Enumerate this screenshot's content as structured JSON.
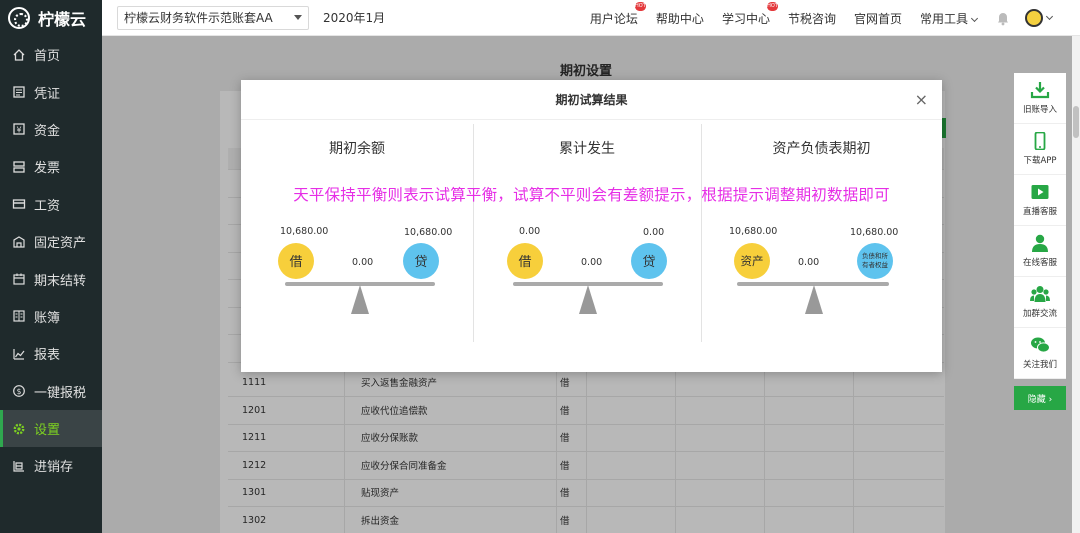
{
  "app": {
    "logo_text": "柠檬云"
  },
  "sidebar": {
    "items": [
      {
        "label": "首页",
        "icon": "home-icon"
      },
      {
        "label": "凭证",
        "icon": "voucher-icon"
      },
      {
        "label": "资金",
        "icon": "fund-icon"
      },
      {
        "label": "发票",
        "icon": "invoice-icon"
      },
      {
        "label": "工资",
        "icon": "salary-icon"
      },
      {
        "label": "固定资产",
        "icon": "asset-icon"
      },
      {
        "label": "期末结转",
        "icon": "calendar-icon"
      },
      {
        "label": "账簿",
        "icon": "book-icon"
      },
      {
        "label": "报表",
        "icon": "report-icon"
      },
      {
        "label": "一键报税",
        "icon": "tax-icon"
      },
      {
        "label": "设置",
        "icon": "gear-icon",
        "active": true
      },
      {
        "label": "进销存",
        "icon": "inventory-icon"
      }
    ]
  },
  "header": {
    "account_select": "柠檬云财务软件示范账套AA",
    "period": "2020年1月",
    "links": [
      "用户论坛",
      "帮助中心",
      "学习中心",
      "节税咨询",
      "官网首页",
      "常用工具"
    ],
    "hot_badge": "HOT"
  },
  "main": {
    "page_title": "期初设置",
    "rows": [
      {
        "code": "1111",
        "name": "买入返售金融资产",
        "dir": "借"
      },
      {
        "code": "1201",
        "name": "应收代位追偿款",
        "dir": "借"
      },
      {
        "code": "1211",
        "name": "应收分保账款",
        "dir": "借"
      },
      {
        "code": "1212",
        "name": "应收分保合同准备金",
        "dir": "借"
      },
      {
        "code": "1301",
        "name": "贴现资产",
        "dir": "借"
      },
      {
        "code": "1302",
        "name": "拆出资金",
        "dir": "借"
      }
    ]
  },
  "modal": {
    "title": "期初试算结果",
    "close": "×",
    "banner": "天平保持平衡则表示试算平衡，试算不平则会有差额提示，根据提示调整期初数据即可",
    "columns": [
      {
        "title": "期初余额",
        "left_amount": "10,680.00",
        "right_amount": "10,680.00",
        "diff": "0.00",
        "left_label": "借",
        "right_label": "贷"
      },
      {
        "title": "累计发生",
        "left_amount": "0.00",
        "right_amount": "0.00",
        "diff": "0.00",
        "left_label": "借",
        "right_label": "贷"
      },
      {
        "title": "资产负债表期初",
        "left_amount": "10,680.00",
        "right_amount": "10,680.00",
        "diff": "0.00",
        "left_label": "资产",
        "right_label_line1": "负债和所",
        "right_label_line2": "有者权益"
      }
    ]
  },
  "rightbar": {
    "items": [
      {
        "label": "旧账导入",
        "icon": "download-icon"
      },
      {
        "label": "下载APP",
        "icon": "phone-icon"
      },
      {
        "label": "直播客服",
        "icon": "video-icon"
      },
      {
        "label": "在线客服",
        "icon": "user-icon"
      },
      {
        "label": "加群交流",
        "icon": "group-icon"
      },
      {
        "label": "关注我们",
        "icon": "wechat-icon"
      }
    ],
    "hide_label": "隐藏 ›"
  },
  "colors": {
    "sidebar_bg": "#1f2a2c",
    "accent_green": "#27a745",
    "banner_magenta": "#e62ee6",
    "debit_yellow": "#f7cf3b",
    "credit_blue": "#5ec3ee"
  }
}
